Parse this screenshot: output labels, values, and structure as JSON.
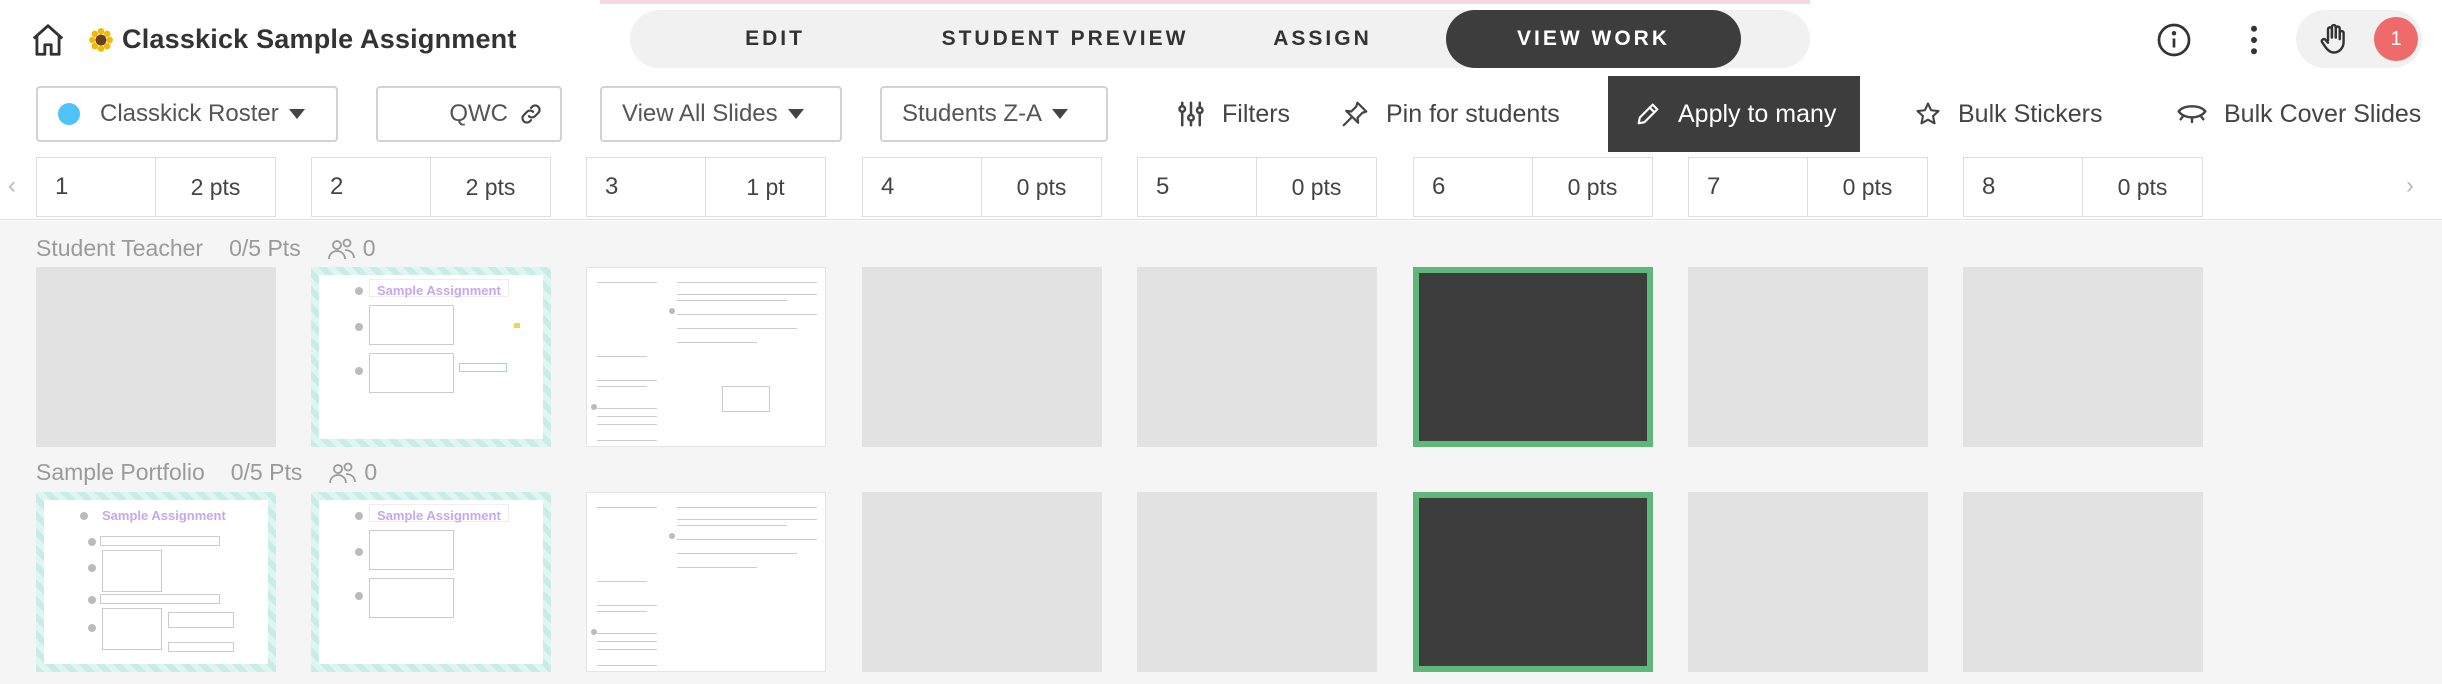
{
  "header": {
    "title": "Classkick Sample Assignment",
    "tabs": [
      {
        "label": "EDIT"
      },
      {
        "label": "STUDENT PREVIEW"
      },
      {
        "label": "ASSIGN"
      },
      {
        "label": "VIEW WORK"
      }
    ],
    "help_badge": "1"
  },
  "toolbar": {
    "roster": "Classkick Roster",
    "code": "QWC",
    "slides_filter": "View All Slides",
    "sort": "Students Z-A",
    "filters": "Filters",
    "pin": "Pin for students",
    "apply": "Apply to many",
    "stickers": "Bulk Stickers",
    "cover": "Bulk Cover Slides"
  },
  "slides": [
    {
      "num": "1",
      "pts": "2 pts"
    },
    {
      "num": "2",
      "pts": "2 pts"
    },
    {
      "num": "3",
      "pts": "1 pt"
    },
    {
      "num": "4",
      "pts": "0 pts"
    },
    {
      "num": "5",
      "pts": "0 pts"
    },
    {
      "num": "6",
      "pts": "0 pts"
    },
    {
      "num": "7",
      "pts": "0 pts"
    },
    {
      "num": "8",
      "pts": "0 pts"
    }
  ],
  "students": [
    {
      "name": "Student Teacher",
      "score": "0/5 Pts",
      "help": "0"
    },
    {
      "name": "Sample Portfolio",
      "score": "0/5 Pts",
      "help": "0"
    }
  ],
  "thumbnail_text": {
    "title": "Sample Assignment"
  },
  "colors": {
    "accent_dark": "#3d3d3d",
    "selected_border": "#5fb87a",
    "roster_dot": "#4fc3f7",
    "badge": "#ef6b6b",
    "thumb_pattern": "#c9ece6"
  }
}
